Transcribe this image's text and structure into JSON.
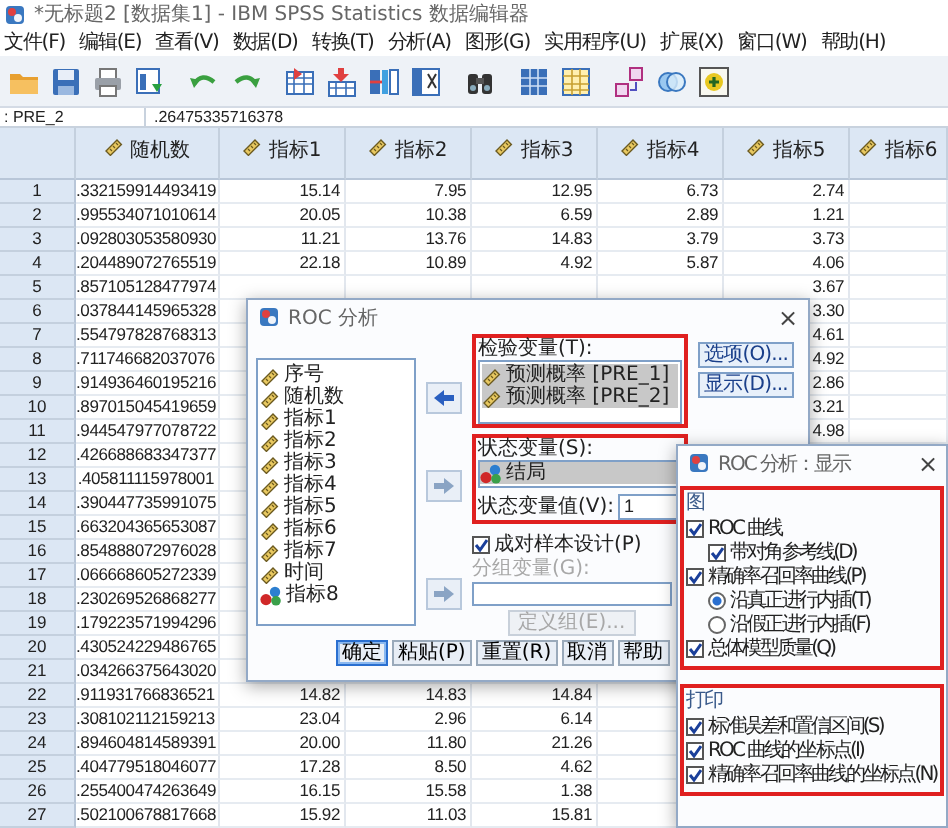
{
  "window": {
    "title": "*无标题2 [数据集1] - IBM SPSS Statistics 数据编辑器"
  },
  "menu": [
    "文件(F)",
    "编辑(E)",
    "查看(V)",
    "数据(D)",
    "转换(T)",
    "分析(A)",
    "图形(G)",
    "实用程序(U)",
    "扩展(X)",
    "窗口(W)",
    "帮助(H)"
  ],
  "cell_reference": {
    "name": ": PRE_2",
    "value": ".26475335716378"
  },
  "grid": {
    "columns": [
      "随机数",
      "指标1",
      "指标2",
      "指标3",
      "指标4",
      "指标5",
      "指标6"
    ],
    "rows": [
      {
        "number": "1",
        "cells": [
          ".332159914493419",
          "15.14",
          "7.95",
          "12.95",
          "6.73",
          "2.74"
        ]
      },
      {
        "number": "2",
        "cells": [
          ".995534071010614",
          "20.05",
          "10.38",
          "6.59",
          "2.89",
          "1.21"
        ]
      },
      {
        "number": "3",
        "cells": [
          ".092803053580930",
          "11.21",
          "13.76",
          "14.83",
          "3.79",
          "3.73"
        ]
      },
      {
        "number": "4",
        "cells": [
          ".204489072765519",
          "22.18",
          "10.89",
          "4.92",
          "5.87",
          "4.06"
        ]
      },
      {
        "number": "5",
        "cells": [
          ".857105128477974",
          null,
          null,
          null,
          null,
          "3.67"
        ]
      },
      {
        "number": "6",
        "cells": [
          ".037844145965328",
          null,
          null,
          null,
          null,
          "3.30"
        ]
      },
      {
        "number": "7",
        "cells": [
          ".554797828768313",
          null,
          null,
          null,
          null,
          "4.61"
        ]
      },
      {
        "number": "8",
        "cells": [
          ".711746682037076",
          null,
          null,
          null,
          null,
          "4.92"
        ]
      },
      {
        "number": "9",
        "cells": [
          ".914936460195216",
          null,
          null,
          null,
          null,
          "2.86"
        ]
      },
      {
        "number": "10",
        "cells": [
          ".897015045419659",
          null,
          null,
          null,
          null,
          "3.21"
        ]
      },
      {
        "number": "11",
        "cells": [
          ".944547977078722",
          null,
          null,
          null,
          null,
          "4.98"
        ]
      },
      {
        "number": "12",
        "cells": [
          ".426688683347377"
        ]
      },
      {
        "number": "13",
        "cells": [
          ".405811115978001"
        ]
      },
      {
        "number": "14",
        "cells": [
          ".390447735991075"
        ]
      },
      {
        "number": "15",
        "cells": [
          ".663204365653087"
        ]
      },
      {
        "number": "16",
        "cells": [
          ".854888072976028"
        ]
      },
      {
        "number": "17",
        "cells": [
          ".066668605272339"
        ]
      },
      {
        "number": "18",
        "cells": [
          ".230269526868277"
        ]
      },
      {
        "number": "19",
        "cells": [
          ".179223571994296"
        ]
      },
      {
        "number": "20",
        "cells": [
          ".430524229486765"
        ]
      },
      {
        "number": "21",
        "cells": [
          ".034266375643020"
        ]
      },
      {
        "number": "22",
        "cells": [
          ".911931766836521",
          "14.82",
          "14.83",
          "14.84"
        ]
      },
      {
        "number": "23",
        "cells": [
          ".308102112159213",
          "23.04",
          "2.96",
          "6.14"
        ]
      },
      {
        "number": "24",
        "cells": [
          ".894604814589391",
          "20.00",
          "11.80",
          "21.26"
        ]
      },
      {
        "number": "25",
        "cells": [
          ".404779518046077",
          "17.28",
          "8.50",
          "4.62"
        ]
      },
      {
        "number": "26",
        "cells": [
          ".255400474263649",
          "16.15",
          "15.58",
          "1.38"
        ]
      },
      {
        "number": "27",
        "cells": [
          ".502100678817668",
          "15.92",
          "11.03",
          "15.81"
        ]
      }
    ]
  },
  "roc_dialog": {
    "title": "ROC 分析",
    "close": "×",
    "source_variables": [
      {
        "name": "序号",
        "kind": "scale",
        "selected": false
      },
      {
        "name": "随机数",
        "kind": "scale",
        "selected": false
      },
      {
        "name": "指标1",
        "kind": "scale",
        "selected": false
      },
      {
        "name": "指标2",
        "kind": "scale",
        "selected": false
      },
      {
        "name": "指标3",
        "kind": "scale",
        "selected": false
      },
      {
        "name": "指标4",
        "kind": "scale",
        "selected": false
      },
      {
        "name": "指标5",
        "kind": "scale",
        "selected": false
      },
      {
        "name": "指标6",
        "kind": "scale",
        "selected": false
      },
      {
        "name": "指标7",
        "kind": "scale",
        "selected": false
      },
      {
        "name": "时间",
        "kind": "scale",
        "selected": false
      },
      {
        "name": "指标8",
        "kind": "nominal",
        "selected": false
      }
    ],
    "arrows": [
      {
        "kind": "left",
        "disabled": false
      },
      {
        "kind": "right",
        "disabled": true
      },
      {
        "kind": "right",
        "disabled": true
      }
    ],
    "test_variables": {
      "label": "检验变量(T):",
      "highlighted": true,
      "items": [
        {
          "name": "预测概率 [PRE_1]",
          "kind": "scale",
          "selected": true
        },
        {
          "name": "预测概率 [PRE_2]",
          "kind": "scale",
          "selected": true
        }
      ]
    },
    "state_variable": {
      "label": "状态变量(S):",
      "highlighted": true,
      "item": {
        "name": "结局",
        "kind": "nominal",
        "selected": true
      },
      "value_label": "状态变量值(V):",
      "value": "1"
    },
    "paired_design": {
      "label": "成对样本设计(P)",
      "checked": true
    },
    "grouping_variable": {
      "label": "分组变量(G):",
      "disabled": true
    },
    "define_groups_button": {
      "label": "定义组(E)...",
      "disabled": true
    },
    "side_buttons": [
      "选项(O)...",
      "显示(D)..."
    ],
    "buttons": [
      {
        "label": "确定",
        "default": true
      },
      {
        "label": "粘贴(P)",
        "default": false
      },
      {
        "label": "重置(R)",
        "default": false
      },
      {
        "label": "取消",
        "default": false
      },
      {
        "label": "帮助",
        "default": false
      }
    ]
  },
  "display_dialog": {
    "title": "ROC 分析：显示",
    "close": "×",
    "groups": [
      {
        "label": "图",
        "highlighted": true,
        "options": [
          {
            "kind": "checkbox",
            "label": "ROC 曲线",
            "checked": true,
            "children": [
              {
                "kind": "checkbox",
                "label": "带对角参考线(D)",
                "checked": true
              }
            ]
          },
          {
            "kind": "checkbox",
            "label": "精确率召回率曲线(P)",
            "checked": true,
            "children": [
              {
                "kind": "radio",
                "label": "沿真正进行内插(T)",
                "selected": true
              },
              {
                "kind": "radio",
                "label": "沿假正进行内插(F)",
                "selected": false
              }
            ]
          },
          {
            "kind": "checkbox",
            "label": "总体模型质量(Q)",
            "checked": true
          }
        ]
      },
      {
        "label": "打印",
        "highlighted": true,
        "options": [
          {
            "kind": "checkbox",
            "label": "标准误差和置信区间(S)",
            "checked": true
          },
          {
            "kind": "checkbox",
            "label": "ROC 曲线的坐标点(I)",
            "checked": true
          },
          {
            "kind": "checkbox",
            "label": "精确率召回率曲线的坐标点(N)",
            "checked": true
          }
        ]
      }
    ]
  }
}
